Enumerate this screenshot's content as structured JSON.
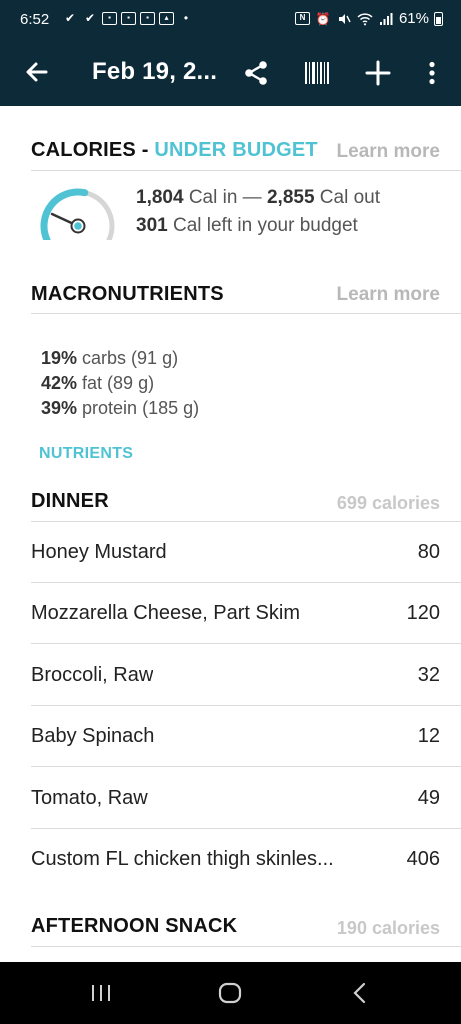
{
  "status_bar": {
    "time": "6:52",
    "battery": "61%"
  },
  "app_bar": {
    "title": "Feb 19, 2...",
    "icons": [
      "back-arrow-icon",
      "share-icon",
      "barcode-icon",
      "plus-icon",
      "more-vertical-icon"
    ]
  },
  "calories": {
    "title_prefix": "CALORIES - ",
    "title_status": "UNDER BUDGET",
    "learn_more": "Learn more",
    "cal_in_value": "1,804",
    "cal_in_label": " Cal in — ",
    "cal_out_value": "2,855",
    "cal_out_label": " Cal out",
    "left_value": "301",
    "left_label": " Cal left in your budget",
    "gauge_fraction": 0.63,
    "accent_color": "#4fc3d3"
  },
  "macros": {
    "title": "MACRONUTRIENTS",
    "learn_more": "Learn more",
    "items": [
      {
        "pct": "19%",
        "text": " carbs (91 g)"
      },
      {
        "pct": "42%",
        "text": " fat (89 g)"
      },
      {
        "pct": "39%",
        "text": " protein (185 g)"
      }
    ],
    "nutrients_link": "NUTRIENTS"
  },
  "dinner": {
    "title": "DINNER",
    "calories": "699 calories",
    "items": [
      {
        "name": "Honey Mustard",
        "cal": "80"
      },
      {
        "name": "Mozzarella Cheese, Part Skim",
        "cal": "120"
      },
      {
        "name": "Broccoli, Raw",
        "cal": "32"
      },
      {
        "name": "Baby Spinach",
        "cal": "12"
      },
      {
        "name": "Tomato, Raw",
        "cal": "49"
      },
      {
        "name": "Custom FL chicken thigh skinles...",
        "cal": "406"
      }
    ]
  },
  "afternoon_snack": {
    "title": "AFTERNOON SNACK",
    "calories": "190 calories"
  },
  "nav_bar": {
    "icons": [
      "recents-icon",
      "home-icon",
      "back-icon"
    ]
  }
}
